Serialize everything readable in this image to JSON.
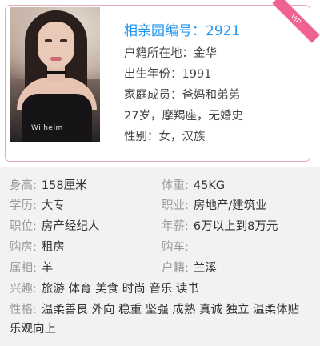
{
  "profile": {
    "vip_badge": "VIP",
    "id_title": "相亲园编号：2921",
    "hometown": "户籍所在地：金华",
    "birth_year": "出生年份：1991",
    "family": "家庭成员：爸妈和弟弟",
    "summary": "27岁，摩羯座，无婚史",
    "gender": "性别：女，汉族",
    "photo_shirt_print": "Wilhelm"
  },
  "details": {
    "height_label": "身高:",
    "height_value": "158厘米",
    "weight_label": "体重:",
    "weight_value": "45KG",
    "education_label": "学历:",
    "education_value": "大专",
    "job_label": "职业:",
    "job_value": "房地产/建筑业",
    "position_label": "职位:",
    "position_value": "房产经纪人",
    "salary_label": "年薪:",
    "salary_value": "6万以上到8万元",
    "house_label": "购房:",
    "house_value": "租房",
    "car_label": "购车:",
    "car_value": "",
    "zodiac_label": "属相:",
    "zodiac_value": "羊",
    "registry_label": "户籍:",
    "registry_value": "兰溪",
    "hobbies_label": "兴趣:",
    "hobbies_value": "旅游 体育 美食 时尚 音乐 读书",
    "personality_label": "性格:",
    "personality_value": "温柔善良 外向 稳重 坚强 成熟 真诚 独立 温柔体贴 乐观向上"
  },
  "colors": {
    "accent_blue": "#2196f3",
    "vip_pink": "#f06292",
    "card_border": "#e8a9bf",
    "details_bg": "#f2f2f2"
  }
}
